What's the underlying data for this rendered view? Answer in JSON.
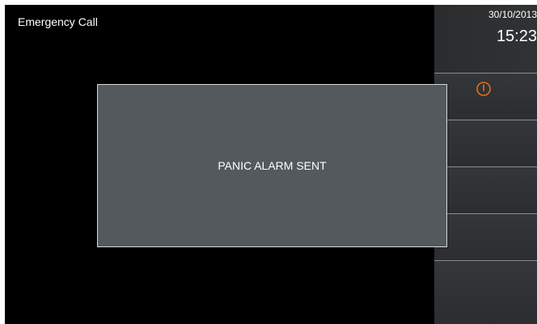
{
  "header": {
    "title": "Emergency Call"
  },
  "clock": {
    "date": "30/10/2013",
    "time": "15:23"
  },
  "sidebar": {
    "buttons": [
      {
        "icon": "power-icon",
        "accent_color": "#f06a1e"
      },
      {
        "icon": ""
      },
      {
        "icon": ""
      },
      {
        "icon": ""
      },
      {
        "icon": ""
      }
    ]
  },
  "dialog": {
    "message": "PANIC ALARM SENT"
  }
}
